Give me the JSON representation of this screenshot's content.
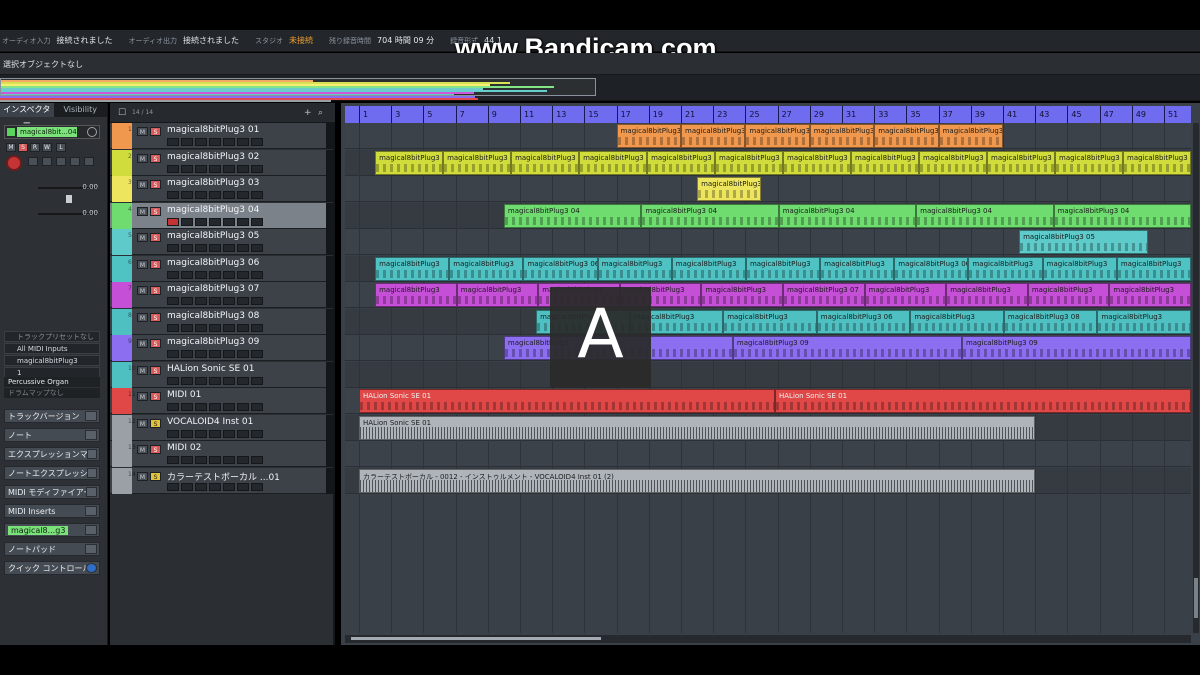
{
  "status_bar": {
    "items": [
      {
        "label": "オーディオ入力",
        "value": "接続されました"
      },
      {
        "label": "オーディオ出力",
        "value": "接続されました"
      },
      {
        "label": "スタジオ",
        "value": "未接続",
        "warn": true
      },
      {
        "label": "残り録音時間",
        "value": "704 時間 09 分"
      },
      {
        "label": "録音形式",
        "value": "44.1"
      }
    ]
  },
  "watermark": "www.Bandicam.com",
  "info_line": "選択オブジェクトなし",
  "overview_colors": [
    "#f3a55a",
    "#d4e14a",
    "#f6ee6c",
    "#7ee37f",
    "#67c9c9",
    "#5ecaca",
    "#c84fd8",
    "#5cc7c7",
    "#8a6df0",
    "#e14b4b",
    "#9aa0a6"
  ],
  "inspector": {
    "tabs": [
      "インスペクター",
      "Visibility"
    ],
    "track_name": "magical8bit...04",
    "btn_m": "M",
    "btn_s": "S",
    "btn_r": "R",
    "btn_w": "W",
    "btn_l": "L",
    "volume": "0.00",
    "pan": "0.00",
    "routing": [
      "トラックプリセットなし",
      "All MIDI Inputs",
      "magical8bitPlug3",
      "1"
    ],
    "program": [
      "Percussive Organ",
      "ドラムマップなし"
    ],
    "sections": [
      {
        "label": "トラックバージョン",
        "style": ""
      },
      {
        "label": "ノート",
        "style": ""
      },
      {
        "label": "エクスプレッションマップ",
        "style": ""
      },
      {
        "label": "ノートエクスプレッション",
        "style": ""
      },
      {
        "label": "MIDI モディファイアー",
        "style": ""
      },
      {
        "label": "MIDI Inserts",
        "style": ""
      },
      {
        "label": "magical8...g3",
        "style": "green"
      },
      {
        "label": "ノートパッド",
        "style": ""
      },
      {
        "label": "クイック コントロール",
        "style": "blue"
      }
    ]
  },
  "tracklist": {
    "count": "14 / 14",
    "mute_label": "M",
    "solo_label": "S",
    "tracks": [
      {
        "num": "1",
        "name": "magical8bitPlug3 01",
        "color": "#f0994e"
      },
      {
        "num": "2",
        "name": "magical8bitPlug3 02",
        "color": "#d0dc3c"
      },
      {
        "num": "3",
        "name": "magical8bitPlug3 03",
        "color": "#eee55e"
      },
      {
        "num": "4",
        "name": "magical8bitPlug3 04",
        "color": "#6fdc70",
        "selected": true
      },
      {
        "num": "5",
        "name": "magical8bitPlug3 05",
        "color": "#5fcaca"
      },
      {
        "num": "6",
        "name": "magical8bitPlug3 06",
        "color": "#4fc2c4"
      },
      {
        "num": "7",
        "name": "magical8bitPlug3 07",
        "color": "#c54fd6"
      },
      {
        "num": "8",
        "name": "magical8bitPlug3 08",
        "color": "#4fc0c2"
      },
      {
        "num": "9",
        "name": "magical8bitPlug3 09",
        "color": "#8c6ef0"
      },
      {
        "num": "10",
        "name": "HALion Sonic SE 01",
        "color": "#4fc0c2"
      },
      {
        "num": "11",
        "name": "MIDI 01",
        "color": "#e04848"
      },
      {
        "num": "12",
        "name": "VOCALOID4 Inst 01",
        "color": "#9aa0a6",
        "yellow": true
      },
      {
        "num": "13",
        "name": "MIDI 02",
        "color": "#9aa0a6"
      },
      {
        "num": "14",
        "name": "カラーテストボーカル ...01",
        "color": "#9aa0a6",
        "yellow": true
      }
    ]
  },
  "ruler": [
    "1",
    "3",
    "5",
    "7",
    "9",
    "11",
    "13",
    "15",
    "17",
    "19",
    "21",
    "23",
    "25",
    "27",
    "29",
    "31",
    "33",
    "35",
    "37",
    "39",
    "41",
    "43",
    "45",
    "47",
    "49",
    "51"
  ],
  "events": [
    {
      "row": 0,
      "from": 17,
      "to": 41,
      "color": "#f0994e",
      "parts": [
        "magical8bitPlug3 01",
        "magical8bitPlug3",
        "magical8bitPlug3",
        "magical8bitPlug3",
        "magical8bitPlug3",
        "magical8bitPlug3"
      ]
    },
    {
      "row": 1,
      "from": 2,
      "to": 53,
      "color": "#d0dc3c",
      "parts": [
        "magical8bitPlug3",
        "magical8bitPlug3",
        "magical8bitPlug3",
        "magical8bitPlug3 02",
        "magical8bitPlug3",
        "magical8bitPlug3",
        "magical8bitPlug3",
        "magical8bitPlug3",
        "magical8bitPlug3",
        "magical8bitPlug3",
        "magical8bitPlug3",
        "magical8bitPlug3"
      ]
    },
    {
      "row": 2,
      "from": 22,
      "to": 26,
      "color": "#eee55e",
      "parts": [
        "magical8bitPlug3"
      ]
    },
    {
      "row": 3,
      "from": 10,
      "to": 53,
      "color": "#6fdc70",
      "parts": [
        "magical8bitPlug3 04",
        "magical8bitPlug3 04",
        "magical8bitPlug3 04",
        "magical8bitPlug3 04",
        "magical8bitPlug3 04"
      ]
    },
    {
      "row": 4,
      "from": 42,
      "to": 50,
      "color": "#5fcaca",
      "parts": [
        "magical8bitPlug3 05"
      ]
    },
    {
      "row": 5,
      "from": 2,
      "to": 53,
      "color": "#4fc2c4",
      "parts": [
        "magical8bitPlug3",
        "magical8bitPlug3",
        "magical8bitPlug3 06",
        "magical8bitPlug3",
        "magical8bitPlug3",
        "magical8bitPlug3",
        "magical8bitPlug3",
        "magical8bitPlug3 06",
        "magical8bitPlug3",
        "magical8bitPlug3",
        "magical8bitPlug3"
      ]
    },
    {
      "row": 6,
      "from": 2,
      "to": 53,
      "color": "#c54fd6",
      "parts": [
        "magical8bitPlug3",
        "magical8bitPlug3",
        "magical8bitPlug3",
        "magical8bitPlug3",
        "magical8bitPlug3",
        "magical8bitPlug3 07",
        "magical8bitPlug3",
        "magical8bitPlug3",
        "magical8bitPlug3",
        "magical8bitPlug3"
      ]
    },
    {
      "row": 7,
      "from": 12,
      "to": 53,
      "color": "#4fc0c2",
      "parts": [
        "magical8bitPlug3",
        "magical8bitPlug3",
        "magical8bitPlug3",
        "magical8bitPlug3 06",
        "magical8bitPlug3",
        "magical8bitPlug3 08",
        "magical8bitPlug3"
      ]
    },
    {
      "row": 8,
      "from": 10,
      "to": 53,
      "color": "#8c6ef0",
      "parts": [
        "magical8bitPlug3",
        "magical8bitPlug3 09",
        "magical8bitPlug3 09"
      ]
    },
    {
      "row": 10,
      "from": 1,
      "to": 53,
      "color": "#e04848",
      "dark": true,
      "parts": [
        "HALion Sonic SE 01",
        "HALion Sonic SE 01"
      ]
    },
    {
      "row": 11,
      "from": 1,
      "to": 43,
      "color": "#aeb4ba",
      "wave": true,
      "parts": [
        "HALion Sonic SE 01"
      ]
    },
    {
      "row": 13,
      "from": 1,
      "to": 43,
      "color": "#aeb4ba",
      "wave": true,
      "parts": [
        "カラーテストボーカル - 0012 - インストゥルメント - VOCALOID4 Inst 01 (2)"
      ]
    }
  ],
  "key_overlay": "A"
}
